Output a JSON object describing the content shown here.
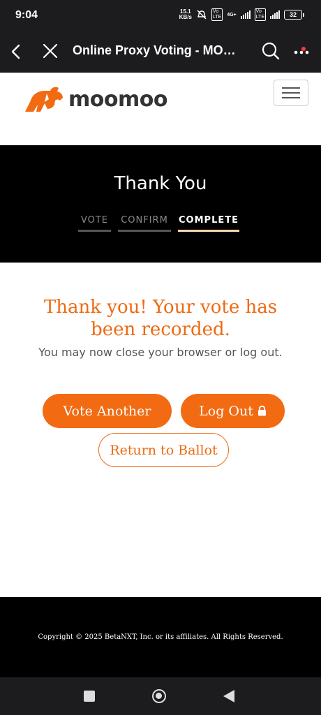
{
  "status_bar": {
    "time": "9:04",
    "net_speed_value": "15.1",
    "net_speed_unit": "KB/s",
    "network_type": "4G+",
    "volte_label": "Vo LTE",
    "battery_level": "32"
  },
  "app_bar": {
    "title": "Online Proxy Voting - MO…",
    "icons": [
      "back-icon",
      "close-icon",
      "search-icon",
      "more-icon"
    ],
    "notification_dot_color": "#ff3b30"
  },
  "site_header": {
    "logo_text": "moomoo",
    "brand_color": "#f26b12",
    "menu_icon": "hamburger-icon"
  },
  "hero": {
    "title": "Thank You",
    "steps": [
      {
        "label": "VOTE",
        "state": "done"
      },
      {
        "label": "CONFIRM",
        "state": "done"
      },
      {
        "label": "COMPLETE",
        "state": "active"
      }
    ]
  },
  "main": {
    "heading": "Thank you! Your vote has been recorded.",
    "subtext": "You may now close your browser or log out.",
    "buttons": {
      "vote_another": "Vote Another",
      "log_out": "Log Out",
      "return_to_ballot": "Return to Ballot"
    },
    "accent_color": "#ee6a12"
  },
  "footer": {
    "copyright": "Copyright © 2025 BetaNXT, Inc. or its affiliates. All Rights Reserved."
  },
  "nav_bar": {
    "icons": [
      "recents-icon",
      "home-icon",
      "back-icon"
    ]
  }
}
